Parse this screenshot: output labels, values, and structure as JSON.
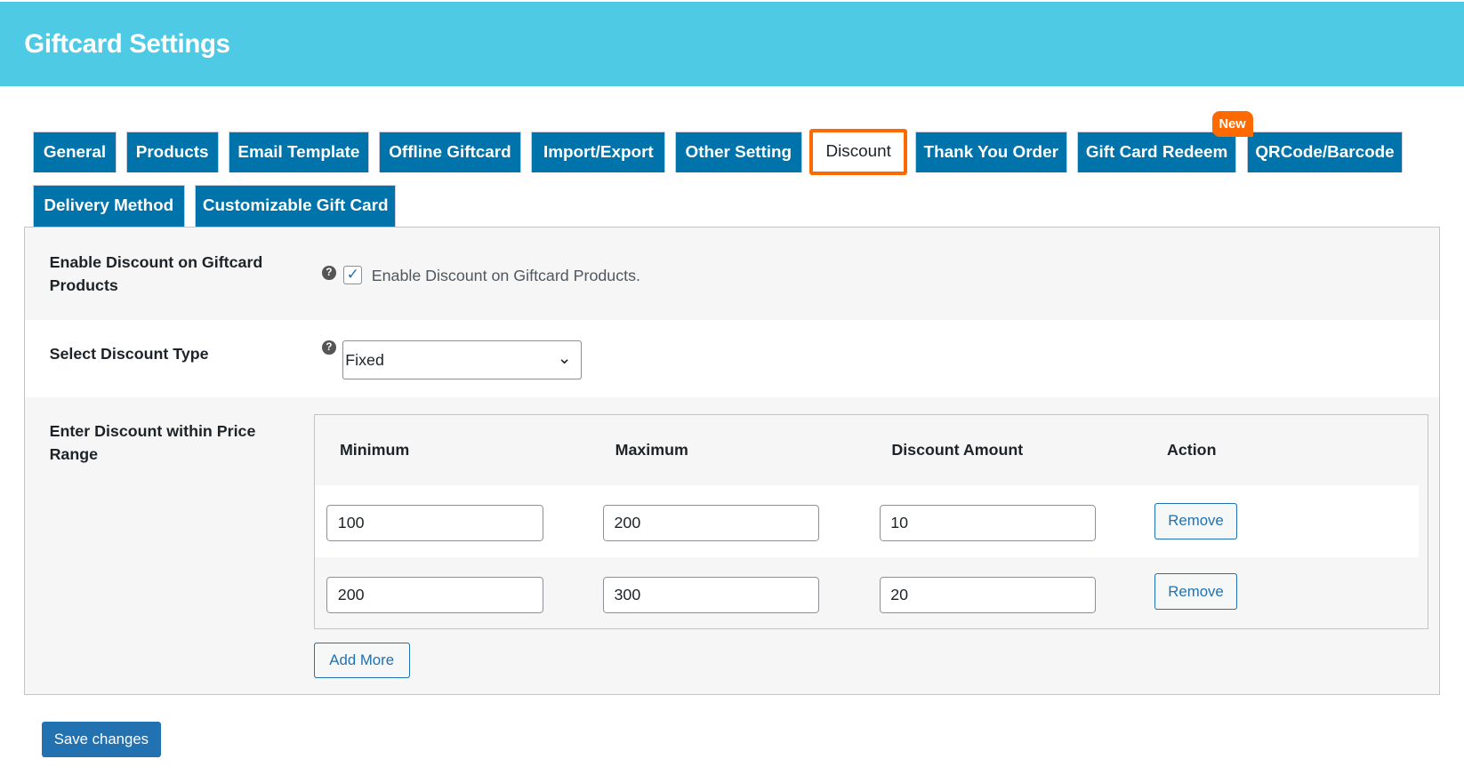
{
  "header": {
    "title": "Giftcard Settings"
  },
  "tabs": [
    "General",
    "Products",
    "Email Template",
    "Offline Giftcard",
    "Import/Export",
    "Other Setting",
    "Discount",
    "Thank You Order",
    "Gift Card Redeem",
    "QRCode/Barcode",
    "Delivery Method",
    "Customizable Gift Card"
  ],
  "active_tab": "Discount",
  "badge": "New",
  "settings": {
    "enable_label": "Enable Discount on Giftcard Products",
    "enable_checkbox_text": "Enable Discount on Giftcard Products.",
    "enable_checked": true,
    "type_label": "Select Discount Type",
    "type_value": "Fixed",
    "range_label": "Enter Discount within Price Range"
  },
  "table": {
    "headers": [
      "Minimum",
      "Maximum",
      "Discount Amount",
      "Action"
    ],
    "rows": [
      {
        "min": "100",
        "max": "200",
        "amount": "10",
        "action": "Remove"
      },
      {
        "min": "200",
        "max": "300",
        "amount": "20",
        "action": "Remove"
      }
    ],
    "add_more": "Add More"
  },
  "save_label": "Save changes",
  "colors": {
    "header": "#4ecae4",
    "tab": "#0073aa",
    "active_border": "#ff6a00",
    "primary": "#2271b1"
  }
}
